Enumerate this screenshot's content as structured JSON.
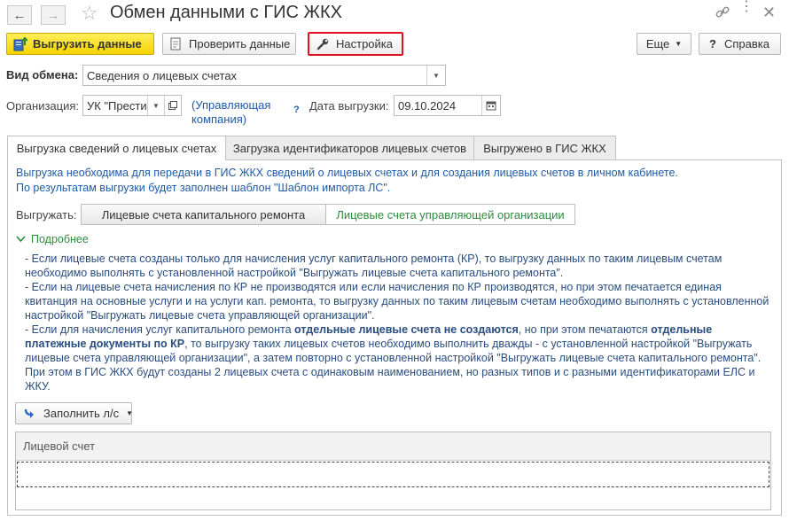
{
  "window": {
    "title": "Обмен данными с ГИС ЖКХ"
  },
  "toolbar": {
    "upload_label": "Выгрузить данные",
    "check_label": "Проверить данные",
    "settings_label": "Настройка",
    "more_label": "Еще",
    "help_label": "Справка",
    "help_prefix": "?"
  },
  "form": {
    "exchange_type_label": "Вид обмена:",
    "exchange_type_value": "Сведения о лицевых счетах",
    "org_label": "Организация:",
    "org_value": "УК \"Прести",
    "org_type": "(Управляющая компания)",
    "help_mark": "?",
    "date_label": "Дата выгрузки:",
    "date_value": "09.10.2024"
  },
  "tabs": [
    {
      "label": "Выгрузка сведений о лицевых счетах",
      "active": true
    },
    {
      "label": "Загрузка идентификаторов лицевых счетов",
      "active": false
    },
    {
      "label": "Выгружено в ГИС ЖКХ",
      "active": false
    }
  ],
  "panel": {
    "info_line1": "Выгрузка необходима для передачи в ГИС ЖКХ сведений о лицевых счетах и для создания лицевых счетов в личном кабинете.",
    "info_line2": "По результатам выгрузки будет заполнен шаблон \"Шаблон импорта ЛС\".",
    "upload_kind_label": "Выгружать:",
    "option_capital": "Лицевые счета капитального ремонта",
    "option_management": "Лицевые счета управляющей организации",
    "details_label": "Подробнее",
    "desc": {
      "p1": "- Если лицевые счета созданы только для начисления услуг капитального ремонта (КР), то выгрузку данных по таким лицевым счетам необходимо выполнять с установленной настройкой \"Выгружать лицевые счета капитального ремонта\".",
      "p2": "- Если на лицевые счета начисления по КР не производятся или если начисления по КР производятся, но при этом печатается единая квитанция на основные услуги и на услуги кап. ремонта, то выгрузку данных по таким лицевым счетам необходимо выполнять с установленной настройкой \"Выгружать лицевые счета управляющей организации\".",
      "p3_a": "- Если для начисления услуг капитального ремонта ",
      "p3_b": "отдельные лицевые счета не создаются",
      "p3_c": ", но при этом печатаются ",
      "p3_d": "отдельные платежные документы по КР",
      "p3_e": ", то выгрузку таких лицевых счетов необходимо выполнить дважды - с установленной настройкой \"Выгружать лицевые счета управляющей организации\", а затем повторно с установленной настройкой \"Выгружать лицевые счета капитального ремонта\". При этом в ГИС ЖКХ будут созданы 2 лицевых счета с одинаковым наименованием, но разных типов и с разными идентификаторами ЕЛС и ЖКУ."
    },
    "fill_label": "Заполнить л/с",
    "table": {
      "column": "Лицевой счет"
    }
  },
  "colors": {
    "accent_blue": "#1f5aa6",
    "primary_yellow": "#f5d400",
    "highlight_red": "#e0141e",
    "option_green": "#2e8b3c"
  }
}
